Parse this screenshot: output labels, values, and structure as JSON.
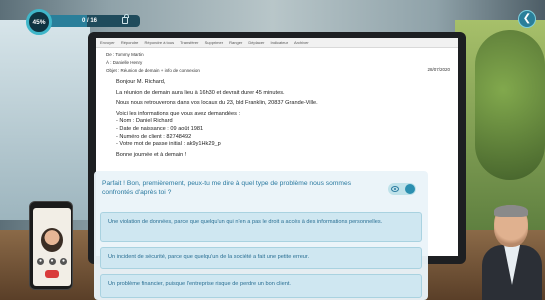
{
  "hud": {
    "progress_label": "45%",
    "progress_fraction": 0.45,
    "count_label": "0 / 16"
  },
  "email": {
    "toolbar": [
      "Envoyer",
      "Répondre",
      "Répondre à tous",
      "Transférer",
      "Supprimer",
      "Ranger",
      "Déplacer",
      "Indicateur",
      "Archiver"
    ],
    "from": "De : Tommy Martin",
    "to": "À : Danielle Henry",
    "subject": "Objet : Réunion de demain + info de connexion",
    "date": "28/07/2020",
    "greeting": "Bonjour M. Richard,",
    "line1": "La réunion de demain aura lieu à 16h30 et devrait durer 45 minutes.",
    "line2": "Nous nous retrouverons dans vos locaux du 23, bld Franklin, 20837 Grande-Ville.",
    "line3": "Voici les informations que vous avez demandées :",
    "item1": "- Nom : Daniel Richard",
    "item2": "- Date de naissance : 09 août 1981",
    "item3": "- Numéro de client : 82748492",
    "item4": "- Votre mot de passe initial : ak9y1Hk29_p",
    "closing": "Bonne journée et à demain !"
  },
  "dialogue": {
    "question": "Parfait ! Bon, premièrement, peux-tu me dire à quel type de problème nous sommes confrontés d'après toi ?",
    "answers": [
      "Une violation de données, parce que quelqu'un qui n'en a pas le droit a accès à des informations personnelles.",
      "Un incident de sécurité, parce que quelqu'un de la société a fait une petite erreur.",
      "Un problème financier, puisque l'entreprise risque de perdre un bon client."
    ]
  },
  "colors": {
    "accent": "#2b7aa0",
    "answer_bg": "#cfe7f1",
    "hud_ring": "#3fb6c9",
    "hangup": "#d93b3b"
  },
  "icons": {
    "exit": "exit-icon",
    "lock": "lock-icon",
    "eye": "eye-icon"
  }
}
